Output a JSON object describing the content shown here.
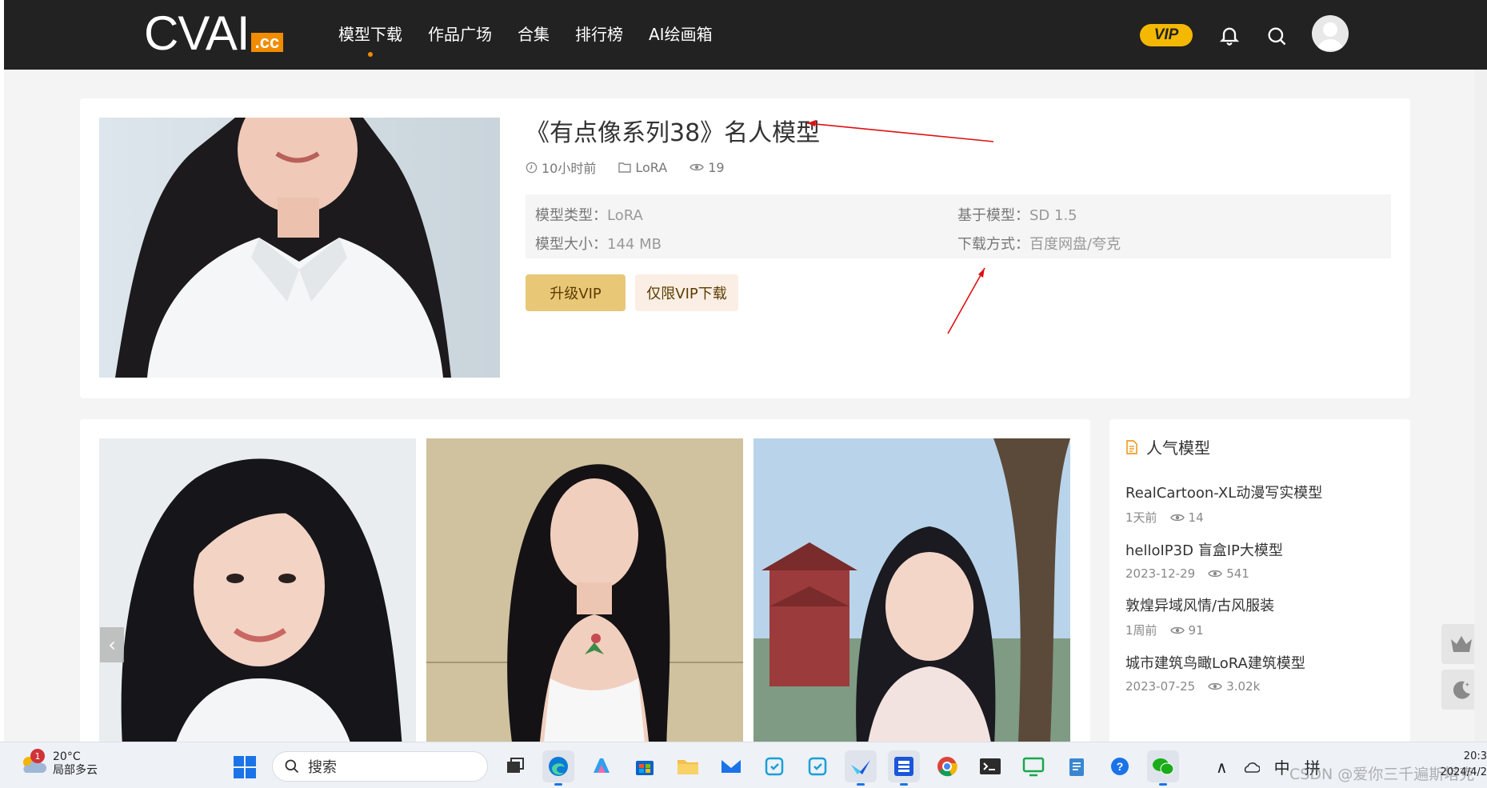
{
  "logo": {
    "text": "CVAI",
    "badge": ".cc"
  },
  "nav": {
    "items": [
      "模型下载",
      "作品广场",
      "合集",
      "排行榜",
      "AI绘画箱"
    ],
    "active_index": 0
  },
  "header": {
    "vip_label": "VIP"
  },
  "model": {
    "title": "《有点像系列38》名人模型",
    "time": "10小时前",
    "category": "LoRA",
    "views": "19",
    "specs": [
      {
        "label": "模型类型：",
        "value": "LoRA"
      },
      {
        "label": "基于模型：",
        "value": "SD 1.5"
      },
      {
        "label": "模型大小：",
        "value": "144 MB"
      },
      {
        "label": "下载方式：",
        "value": "百度网盘/夸克"
      }
    ],
    "upgrade_label": "升级VIP",
    "vip_download_label": "仅限VIP下载"
  },
  "sidebar": {
    "title": "人气模型",
    "items": [
      {
        "title": "RealCartoon-XL动漫写实模型",
        "date": "1天前",
        "views": "14"
      },
      {
        "title": "helloIP3D 盲盒IP大模型",
        "date": "2023-12-29",
        "views": "541"
      },
      {
        "title": "敦煌异域风情/古风服装",
        "date": "1周前",
        "views": "91"
      },
      {
        "title": "城市建筑鸟瞰LoRA建筑模型",
        "date": "2023-07-25",
        "views": "3.02k"
      }
    ]
  },
  "taskbar": {
    "temperature": "20°C",
    "weather": "局部多云",
    "notification_count": "1",
    "search_placeholder": "搜索",
    "ime_lang": "中",
    "ime_mode": "拼",
    "time": "20:3",
    "date": "2024/4/2",
    "watermark": "CSDN @爱你三千遍斯塔克"
  },
  "colors": {
    "accent": "#f08c00",
    "vip": "#f5b800",
    "upgrade_btn": "#e8c777",
    "vip_btn": "#fbeee4"
  },
  "icons": [
    "clock-icon",
    "folder-icon",
    "eye-icon",
    "bell-icon",
    "search-icon",
    "document-icon",
    "crown-icon",
    "moon-icon"
  ]
}
